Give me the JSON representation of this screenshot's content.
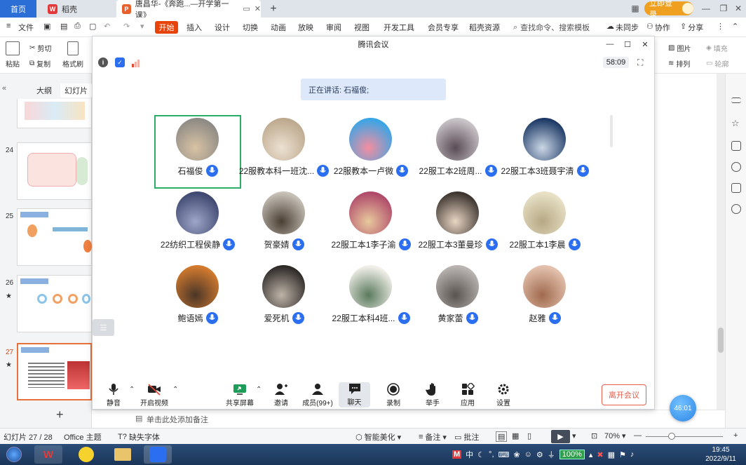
{
  "tabs": {
    "home": "首页",
    "doc": "稻壳",
    "active": "唐昌华-《奔跑...—开学第一课》"
  },
  "header_right": {
    "login": "立即登录"
  },
  "menu": {
    "file": "文件",
    "start": "开始",
    "items": [
      "插入",
      "设计",
      "切换",
      "动画",
      "放映",
      "审阅",
      "视图",
      "开发工具",
      "会员专享",
      "稻壳资源"
    ],
    "search_placeholder": "查找命令、搜索模板",
    "unsynced": "未同步",
    "collab": "协作",
    "share": "分享"
  },
  "toolbar": {
    "paste": "粘贴",
    "cut": "剪切",
    "copy": "复制",
    "format_painter": "格式刷",
    "picture": "图片",
    "fill": "填充",
    "arrange": "排列",
    "outline": "轮廓"
  },
  "left_panel": {
    "tab_outline": "大纲",
    "tab_slides": "幻灯片",
    "slide_numbers": [
      "24",
      "25",
      "26",
      "27"
    ]
  },
  "meeting": {
    "title": "腾讯会议",
    "timer": "58:09",
    "speaking": "正在讲话: 石福俊;",
    "participants": [
      {
        "name": "石福俊",
        "colors": [
          "#8e8a85",
          "#d8c3a4"
        ]
      },
      {
        "name": "22服教本科一班沈...",
        "colors": [
          "#bda98e",
          "#ece1d1"
        ]
      },
      {
        "name": "22服教本一卢微",
        "colors": [
          "#3aa5e6",
          "#f48ea0"
        ]
      },
      {
        "name": "22服工本2班周...",
        "colors": [
          "#c9c4c8",
          "#5b4c56"
        ]
      },
      {
        "name": "22服工本3班聂宇清",
        "colors": [
          "#1d3a66",
          "#cbd7e6"
        ]
      },
      {
        "name": "22纺织工程侯静",
        "colors": [
          "#3f4870",
          "#9ea6c9"
        ]
      },
      {
        "name": "贺豪婧",
        "colors": [
          "#c7c1b8",
          "#4b3f33"
        ]
      },
      {
        "name": "22服工本1李子渝",
        "colors": [
          "#b04a6a",
          "#e8c99d"
        ]
      },
      {
        "name": "22服工本3董曼珍",
        "colors": [
          "#3d3530",
          "#e9d6c4"
        ]
      },
      {
        "name": "22服工本1李晨",
        "colors": [
          "#e8e1c6",
          "#b6a884"
        ]
      },
      {
        "name": "鲍语嫣",
        "colors": [
          "#d27a2e",
          "#4a3628"
        ]
      },
      {
        "name": "爱死机",
        "colors": [
          "#2e2a28",
          "#bfb4a8"
        ]
      },
      {
        "name": "22服工本科4班...",
        "colors": [
          "#f1efe8",
          "#5a7a5e"
        ]
      },
      {
        "name": "黄家蕾",
        "colors": [
          "#b9b4b1",
          "#5a5450"
        ]
      },
      {
        "name": "赵雅",
        "colors": [
          "#e3c1ad",
          "#a06a4e"
        ]
      }
    ],
    "tools": {
      "mute": "静音",
      "video": "开启视频",
      "share_screen": "共享屏幕",
      "invite": "邀请",
      "members": "成员(99+)",
      "chat": "聊天",
      "record": "录制",
      "raise_hand": "举手",
      "apps": "应用",
      "settings": "设置"
    },
    "leave": "离开会议"
  },
  "notes_placeholder": "单击此处添加备注",
  "status": {
    "slide_count": "幻灯片 27 / 28",
    "theme": "Office 主题",
    "missing_font": "缺失字体",
    "smart_beautify": "智能美化",
    "notes": "备注",
    "comments": "批注",
    "zoom": "70%"
  },
  "float_timer": "46:01",
  "taskbar": {
    "battery": "100%",
    "ime": "中",
    "time": "19:45",
    "date": "2022/9/11"
  },
  "colors": {
    "accent": "#2b6fd6",
    "start_tab": "#e8440a",
    "speaker_border": "#2aae67",
    "mic": "#2b6ff0",
    "leave": "#e4604e"
  }
}
